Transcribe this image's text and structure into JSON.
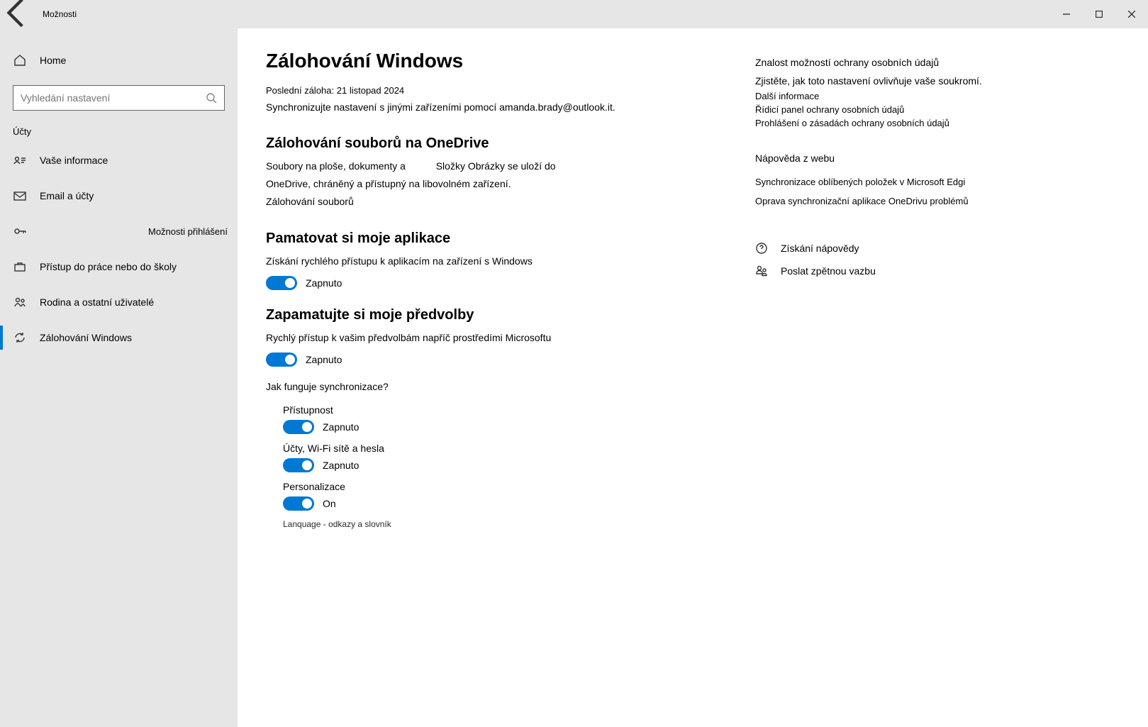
{
  "titlebar": {
    "title": "Možnosti"
  },
  "sidebar": {
    "home": "Home",
    "search_placeholder": "Vyhledání nastavení",
    "header": "Účty",
    "items": [
      {
        "label": "Vaše informace"
      },
      {
        "label": "Email a účty"
      },
      {
        "label": "Možnosti přihlášení"
      },
      {
        "label": "Přístup do práce nebo do školy"
      },
      {
        "label": "Rodina a ostatní uživatelé"
      },
      {
        "label": "Zálohování Windows"
      }
    ]
  },
  "main": {
    "title": "Zálohování Windows",
    "last_backup_label": "Poslední záloha:",
    "last_backup_value": "21 listopad 2024",
    "sync_desc": "Synchronizujte nastavení s jinými zařízeními pomocí amanda.brady@outlook.it.",
    "onedrive": {
      "heading": "Zálohování souborů na OneDrive",
      "text1": "Soubory na ploše, dokumenty a",
      "text2": "Složky Obrázky se uloží do",
      "text3": "OneDrive, chráněný a přístupný na libovolném zařízení.",
      "link": "Zálohování souborů"
    },
    "apps": {
      "heading": "Pamatovat si moje aplikace",
      "desc": "Získání rychlého přístupu k aplikacím na zařízení s Windows",
      "state": "Zapnuto"
    },
    "prefs": {
      "heading": "Zapamatujte si moje předvolby",
      "desc": "Rychlý přístup k vašim předvolbám napříč prostředími Microsoftu",
      "state": "Zapnuto",
      "howlink": "Jak funguje synchronizace?",
      "sub": [
        {
          "label": "Přístupnost",
          "state": "Zapnuto"
        },
        {
          "label": "Účty, Wi-Fi sítě a hesla",
          "state": "Zapnuto"
        },
        {
          "label": "Personalizace",
          "state": "On"
        },
        {
          "label": "Lanquage - odkazy a slovník",
          "state": ""
        }
      ]
    }
  },
  "right": {
    "privacy": {
      "heading": "Znalost možností ochrany osobních údajů",
      "desc": "Zjistěte, jak toto nastavení ovlivňuje vaše soukromí.",
      "links": [
        "Další informace",
        "Řídicí panel ochrany osobních údajů",
        "Prohlášení o zásadách ochrany osobních údajů"
      ]
    },
    "help": {
      "heading": "Nápověda z webu",
      "links": [
        "Synchronizace oblíbených položek v Microsoft Edgi",
        "Oprava synchronizační aplikace OneDrivu problémů"
      ]
    },
    "actions": {
      "get_help": "Získání nápovědy",
      "feedback": "Poslat zpětnou vazbu"
    }
  }
}
